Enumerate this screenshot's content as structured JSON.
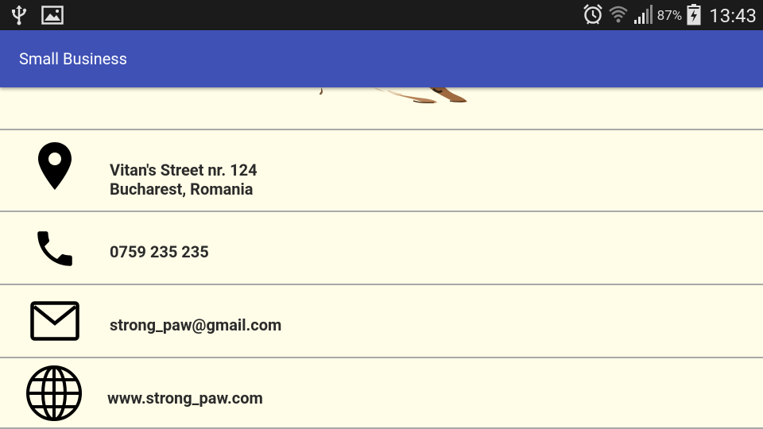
{
  "status_bar": {
    "battery": "87%",
    "time": "13:43",
    "icons": [
      "usb-icon",
      "image-icon",
      "alarm-icon",
      "wifi-icon",
      "signal-icon",
      "battery-charging-icon"
    ]
  },
  "app_bar": {
    "title": "Small Business",
    "color": "#3f51b5"
  },
  "contact": {
    "address_line1": "Vitan's Street nr. 124",
    "address_line2": "Bucharest, Romania",
    "phone": "0759 235 235",
    "email": "strong_paw@gmail.com",
    "website": "www.strong_paw.com"
  },
  "colors": {
    "background": "#fffde7",
    "divider": "#a8a8a8"
  }
}
